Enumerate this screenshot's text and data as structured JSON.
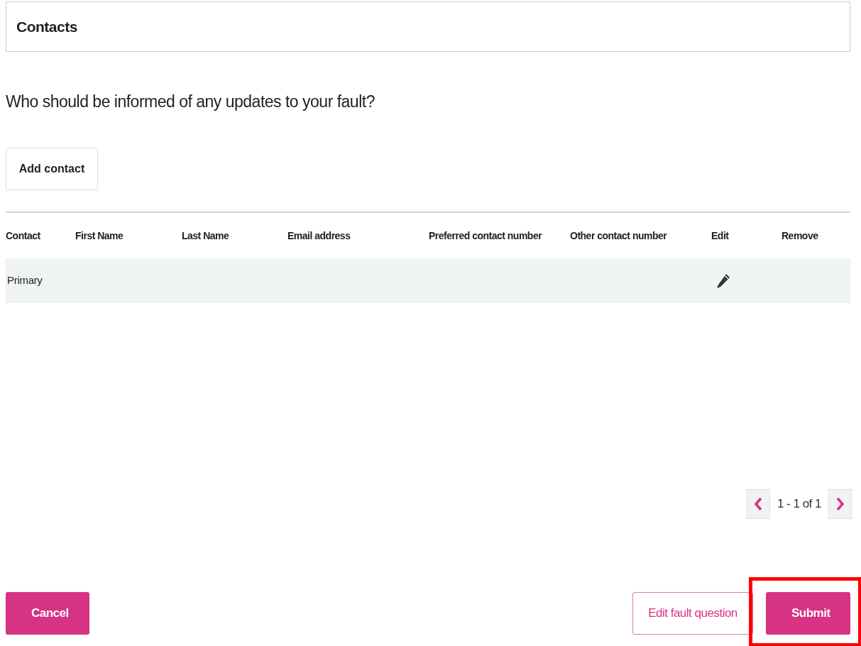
{
  "panel": {
    "title": "Contacts"
  },
  "question": "Who should be informed of any updates to your fault?",
  "add_button": "Add contact",
  "table": {
    "columns": [
      "Contact",
      "First Name",
      "Last Name",
      "Email address",
      "Preferred contact number",
      "Other contact number",
      "Edit",
      "Remove"
    ],
    "rows": [
      {
        "contact": "Primary",
        "editable": true
      }
    ]
  },
  "pagination": {
    "label": "1 - 1 of 1"
  },
  "buttons": [
    {
      "label": "Cancel",
      "kind": "primary",
      "highlighted": false
    },
    {
      "label": "Edit fault question",
      "kind": "outline",
      "highlighted": false
    },
    {
      "label": "Submit",
      "kind": "primary",
      "highlighted": true
    }
  ]
}
